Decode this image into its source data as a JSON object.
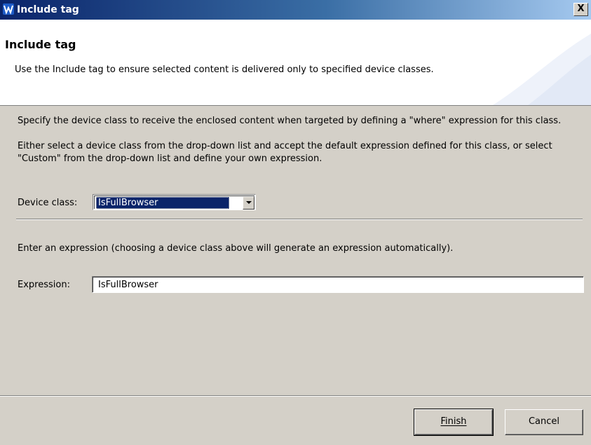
{
  "window": {
    "title": "Include tag",
    "close_label": "X"
  },
  "header": {
    "title": "Include tag",
    "description": "Use the Include tag to ensure selected content is delivered only to specified device classes."
  },
  "body": {
    "paragraph1_line1": "Specify the device class to receive the enclosed content when targeted by defining a \"where\" expression for this class.",
    "paragraph1_line2": "Either select a device class from the drop-down list and accept the default expression defined for this class, or select \"Custom\" from the drop-down list and define your own expression.",
    "device_class_label": "Device class:",
    "device_class_value": "IsFullBrowser",
    "expression_hint": "Enter an expression (choosing a device class above will generate an expression automatically).",
    "expression_label": "Expression:",
    "expression_value": "IsFullBrowser"
  },
  "buttons": {
    "finish": "Finish",
    "cancel": "Cancel"
  }
}
